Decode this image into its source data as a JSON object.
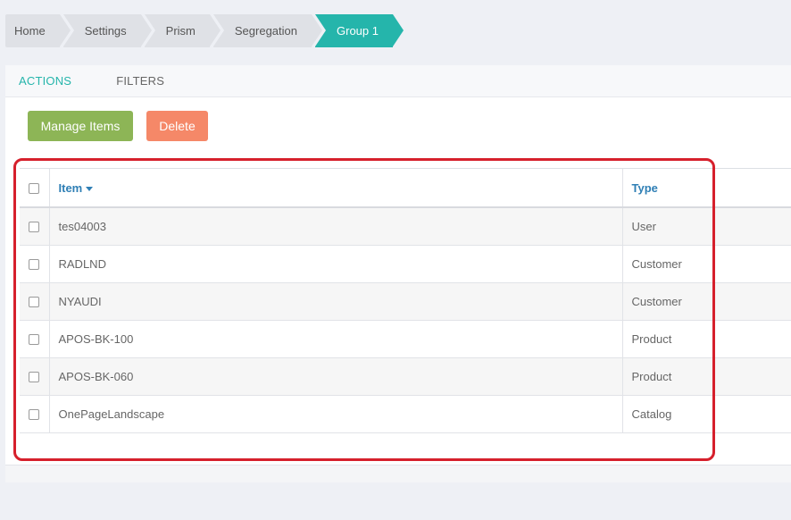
{
  "breadcrumb": [
    {
      "label": "Home",
      "active": false
    },
    {
      "label": "Settings",
      "active": false
    },
    {
      "label": "Prism",
      "active": false
    },
    {
      "label": "Segregation",
      "active": false
    },
    {
      "label": "Group 1",
      "active": true
    }
  ],
  "tabs": {
    "actions": "ACTIONS",
    "filters": "FILTERS"
  },
  "toolbar": {
    "manage_label": "Manage Items",
    "delete_label": "Delete"
  },
  "table": {
    "columns": {
      "item": "Item",
      "type": "Type"
    },
    "rows": [
      {
        "item": "tes04003",
        "type": "User"
      },
      {
        "item": "RADLND",
        "type": "Customer"
      },
      {
        "item": "NYAUDI",
        "type": "Customer"
      },
      {
        "item": "APOS-BK-100",
        "type": "Product"
      },
      {
        "item": "APOS-BK-060",
        "type": "Product"
      },
      {
        "item": "OnePageLandscape",
        "type": "Catalog"
      }
    ]
  },
  "colors": {
    "accent": "#25b5ab",
    "manage_button": "#8db556",
    "delete_button": "#f58868",
    "header_link": "#2f7fb5",
    "highlight": "#d6202c"
  },
  "icons": {
    "sort": "caret-down-icon",
    "checkbox": "checkbox-icon"
  }
}
